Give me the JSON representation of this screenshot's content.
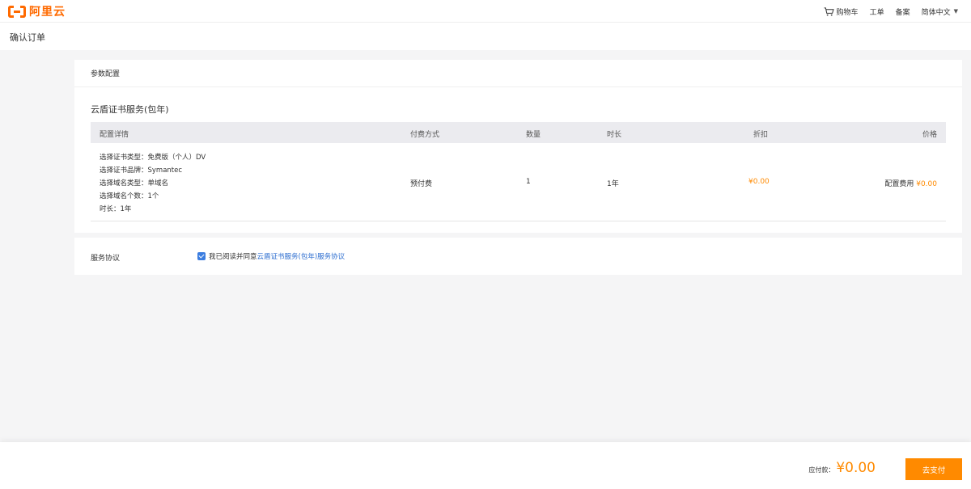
{
  "brand": {
    "logo_text": "阿里云",
    "color": "#ff6a00"
  },
  "topnav": {
    "cart_label": "购物车",
    "ticket_label": "工单",
    "filing_label": "备案",
    "language_label": "简体中文"
  },
  "page": {
    "title": "确认订单"
  },
  "config": {
    "section_title": "参数配置",
    "product_name": "云盾证书服务(包年)",
    "columns": {
      "detail": "配置详情",
      "payment": "付费方式",
      "quantity": "数量",
      "duration": "时长",
      "discount": "折扣",
      "price": "价格"
    },
    "row": {
      "details": [
        "选择证书类型：免费版（个人）DV",
        "选择证书品牌：Symantec",
        "选择域名类型：单域名",
        "选择域名个数：1个",
        "时长：1年"
      ],
      "payment": "预付费",
      "quantity": "1",
      "duration": "1年",
      "discount": "¥0.00",
      "price_label": "配置费用",
      "price_value": "¥0.00"
    }
  },
  "agreement": {
    "label": "服务协议",
    "text": "我已阅读并同意",
    "link": "云盾证书服务(包年)服务协议",
    "checked": true
  },
  "footer": {
    "due_label": "应付款：",
    "due_amount": "¥0.00",
    "pay_button": "去支付",
    "accent": "#ff8a00"
  }
}
